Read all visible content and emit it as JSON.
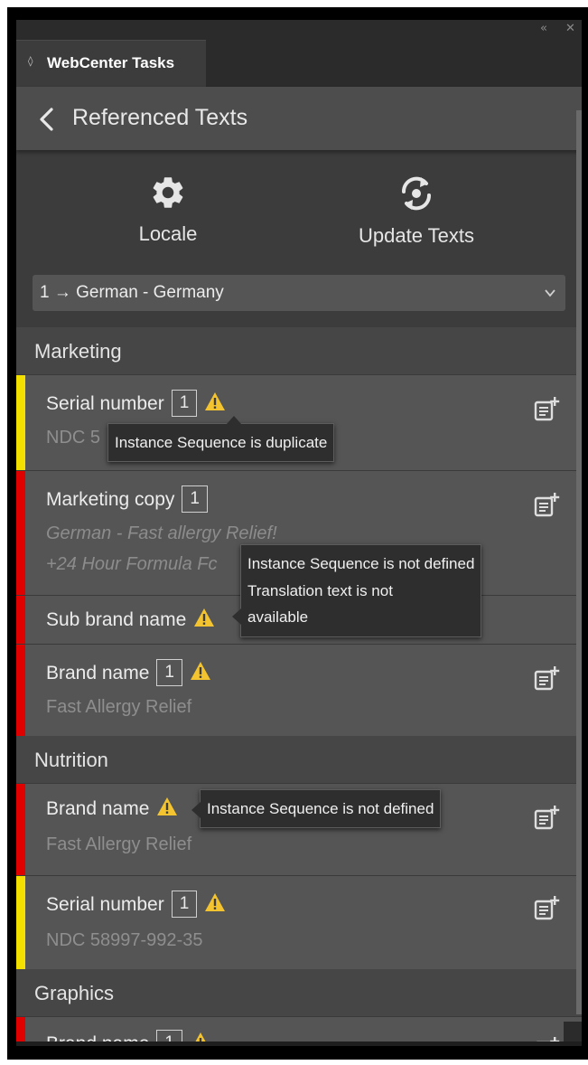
{
  "window": {
    "collapse_glyph": "«",
    "close_glyph": "✕"
  },
  "tab": {
    "chevron": "◊",
    "label": "WebCenter Tasks"
  },
  "header": {
    "title": "Referenced Texts",
    "back_icon": "chevron-left-icon"
  },
  "actions": [
    {
      "label": "Locale",
      "icon": "gear-icon"
    },
    {
      "label": "Update Texts",
      "icon": "refresh-icon"
    }
  ],
  "locale_select": {
    "value": "1 → German - Germany"
  },
  "colors": {
    "panel_bg": "#3c3c3c",
    "row_bg": "#555555",
    "status_yellow": "#f4e000",
    "status_red": "#e10000",
    "warning_icon": "#f4c430",
    "tooltip_bg": "#2e2e2e"
  },
  "sections": [
    {
      "title": "Marketing",
      "rows": [
        {
          "name": "Serial number",
          "seq": "1",
          "warning": true,
          "status": "yellow",
          "value": "NDC 5",
          "tooltip": [
            "Instance Sequence is duplicate"
          ]
        },
        {
          "name": "Marketing copy",
          "seq": "1",
          "warning": false,
          "status": "red",
          "value_lines": [
            "German - Fast allergy Relief!",
            "+24 Hour Formula Fc"
          ],
          "tooltip": [
            "Instance Sequence is not defined",
            "Translation text is not",
            "available"
          ]
        },
        {
          "name": "Sub brand name",
          "seq": null,
          "warning": true,
          "status": "red",
          "value": ""
        },
        {
          "name": "Brand name",
          "seq": "1",
          "warning": true,
          "status": "red",
          "value": "Fast Allergy Relief"
        }
      ]
    },
    {
      "title": "Nutrition",
      "rows": [
        {
          "name": "Brand name",
          "seq": null,
          "warning": true,
          "status": "red",
          "value": "Fast Allergy Relief",
          "tooltip": [
            "Instance Sequence is not defined"
          ]
        },
        {
          "name": "Serial number",
          "seq": "1",
          "warning": true,
          "status": "yellow",
          "value": "NDC 58997-992-35"
        }
      ]
    },
    {
      "title": "Graphics",
      "rows": [
        {
          "name": "Brand name",
          "seq": "1",
          "warning": true,
          "status": "red",
          "value": ""
        }
      ]
    }
  ]
}
